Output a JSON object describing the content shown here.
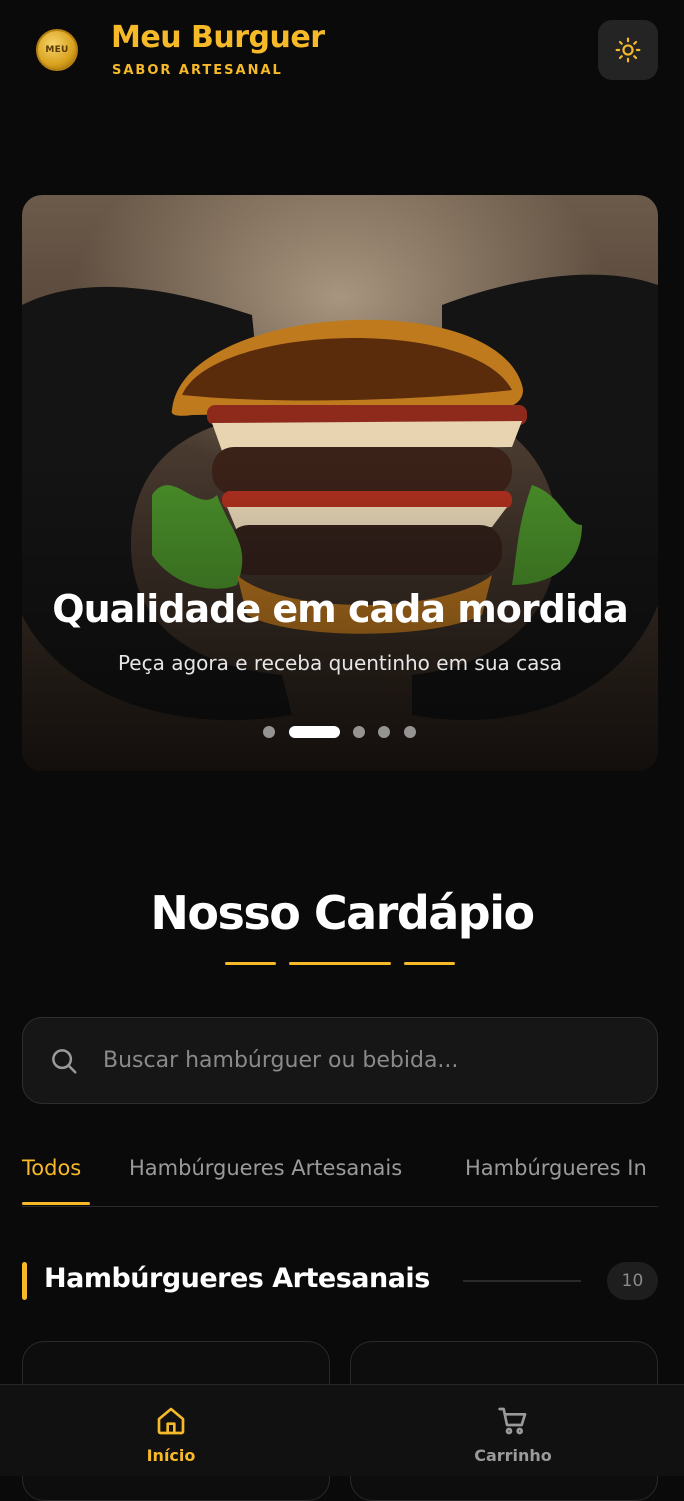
{
  "header": {
    "logo_text": "MEU",
    "title": "Meu Burguer",
    "subtitle": "SABOR ARTESANAL",
    "theme_toggle_icon": "sun-icon"
  },
  "hero": {
    "title": "Qualidade em cada mordida",
    "subtitle": "Peça agora e receba quentinho em sua casa",
    "slides_count": 5,
    "active_slide": 2
  },
  "menu": {
    "title": "Nosso Cardápio",
    "search_placeholder": "Buscar hambúrguer ou bebida...",
    "tabs": [
      {
        "label": "Todos",
        "active": true
      },
      {
        "label": "Hambúrgueres Artesanais",
        "active": false
      },
      {
        "label": "Hambúrgueres In",
        "active": false
      }
    ],
    "category": {
      "title": "Hambúrgueres Artesanais",
      "count": "10"
    }
  },
  "bottom_nav": {
    "items": [
      {
        "label": "Início",
        "icon": "home-icon",
        "active": true
      },
      {
        "label": "Carrinho",
        "icon": "cart-icon",
        "active": false
      }
    ]
  },
  "colors": {
    "accent": "#f6b928",
    "background": "#0a0a0a"
  }
}
